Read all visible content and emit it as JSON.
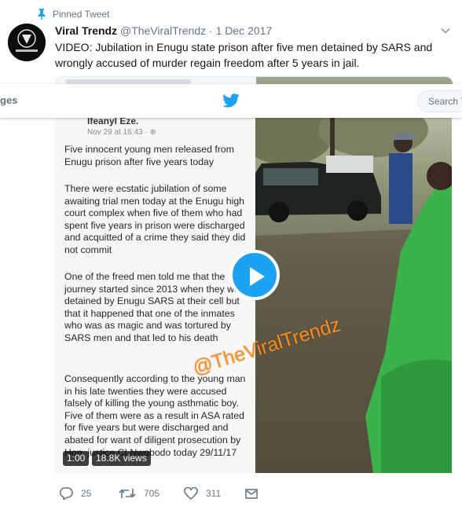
{
  "pinned": {
    "label": "Pinned Tweet",
    "icon": "pin-icon"
  },
  "tweet": {
    "author": "Viral Trendz",
    "handle": "@TheViralTrendz",
    "separator": "·",
    "date": "1 Dec 2017",
    "text": "VIDEO: Jubilation in Enugu state prison after five men detained by SARS and wrongly accused of murder regain freedom after 5 years in jail.",
    "avatar_text": "Viral Trendz"
  },
  "navbar": {
    "messages_label": "ges",
    "search_placeholder": "Search T",
    "logo_icon": "twitter-bird-icon"
  },
  "video": {
    "doc_author": "Ifeanyl Eze.",
    "doc_time": "Nov 29 at 16:43 · ⊕",
    "paragraphs": [
      "Five innocent young men released from Enugu prison after five years today",
      "There were ecstatic  jubilation of some awaiting trial men today at the Enugu high court complex when five of them who had spent five years in prison were discharged and acquitted of a crime they said they did not commit",
      "One of the freed men told me that the journey started since 2013 when they were detained by Enugu SARS at their cell but that it happened that one of the inmates who was as magic and was tortured  by SARS men and that led to his death",
      "Consequently according to the young man in his late twenties they were accused falsely of killing the young asthmatic boy. Five of them were as a result in ASA rated for five years but were discharged and abated for want of diligent prosecution by Hon. justice CI Nwobodo today 29/11/17"
    ],
    "watermark": "@TheViralTrendz",
    "duration": "1:00",
    "views": "18.8K views"
  },
  "actions": {
    "replies": "25",
    "retweets": "705",
    "likes": "311"
  },
  "colors": {
    "accent": "#1da1f2",
    "muted": "#657786",
    "watermark": "#ff8c1a"
  }
}
